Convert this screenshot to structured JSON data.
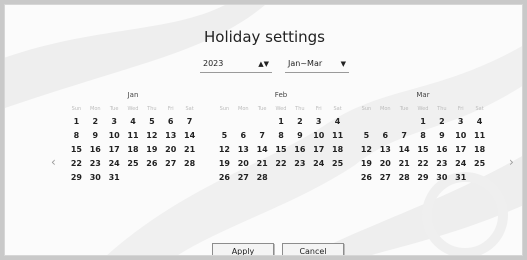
{
  "dialog": {
    "title": "Holiday settings",
    "year_select": {
      "value": "2023"
    },
    "range_select": {
      "value": "Jan~Mar"
    },
    "apply_label": "Apply",
    "cancel_label": "Cancel"
  },
  "weekday_headers": [
    "Sun",
    "Mon",
    "Tue",
    "Wed",
    "Thu",
    "Fri",
    "Sat"
  ],
  "months": [
    {
      "name": "Jan",
      "lead_blanks": 0,
      "days": [
        "1",
        "2",
        "3",
        "4",
        "5",
        "6",
        "7",
        "8",
        "9",
        "10",
        "11",
        "12",
        "13",
        "14",
        "15",
        "16",
        "17",
        "18",
        "19",
        "20",
        "21",
        "22",
        "23",
        "24",
        "25",
        "26",
        "27",
        "28",
        "29",
        "30",
        "31"
      ]
    },
    {
      "name": "Feb",
      "lead_blanks": 3,
      "days": [
        "1",
        "2",
        "3",
        "4",
        "5",
        "6",
        "7",
        "8",
        "9",
        "10",
        "11",
        "12",
        "13",
        "14",
        "15",
        "16",
        "17",
        "18",
        "19",
        "20",
        "21",
        "22",
        "23",
        "24",
        "25",
        "26",
        "27",
        "28"
      ]
    },
    {
      "name": "Mar",
      "lead_blanks": 3,
      "days": [
        "1",
        "2",
        "3",
        "4",
        "5",
        "6",
        "7",
        "8",
        "9",
        "10",
        "11",
        "12",
        "13",
        "14",
        "15",
        "16",
        "17",
        "18",
        "19",
        "20",
        "21",
        "22",
        "23",
        "24",
        "25",
        "26",
        "27",
        "28",
        "29",
        "30",
        "31"
      ]
    }
  ],
  "nav": {
    "prev_icon": "chevron-left-icon",
    "next_icon": "chevron-right-icon"
  }
}
